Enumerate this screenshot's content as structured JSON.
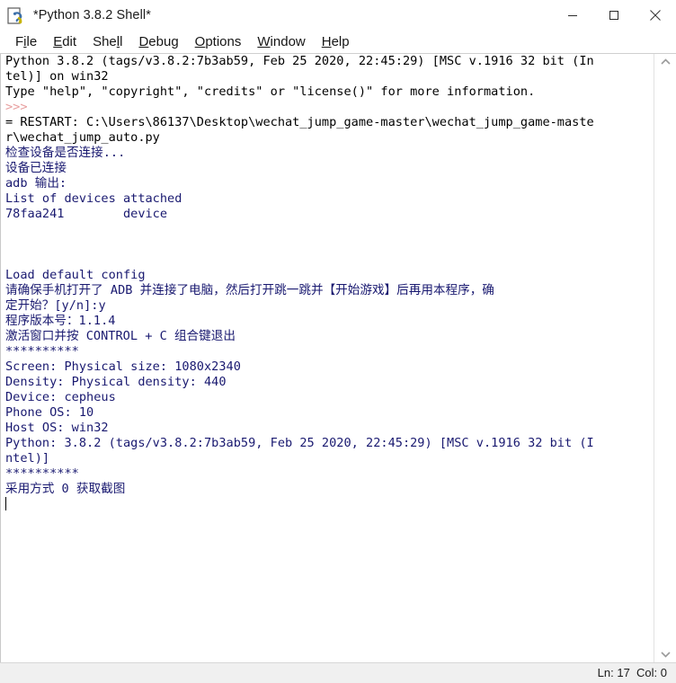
{
  "window": {
    "title": "*Python 3.8.2 Shell*",
    "icon": "python-idle-icon",
    "controls": {
      "minimize": "minimize-icon",
      "maximize": "maximize-icon",
      "close": "close-icon"
    }
  },
  "menubar": {
    "items": [
      {
        "label": "File",
        "pre": "F",
        "acc": "i",
        "post": "le"
      },
      {
        "label": "Edit",
        "pre": "",
        "acc": "E",
        "post": "dit"
      },
      {
        "label": "Shell",
        "pre": "She",
        "acc": "l",
        "post": "l"
      },
      {
        "label": "Debug",
        "pre": "",
        "acc": "D",
        "post": "ebug"
      },
      {
        "label": "Options",
        "pre": "",
        "acc": "O",
        "post": "ptions"
      },
      {
        "label": "Window",
        "pre": "",
        "acc": "W",
        "post": "indow"
      },
      {
        "label": "Help",
        "pre": "",
        "acc": "H",
        "post": "elp"
      }
    ]
  },
  "console": {
    "lines": [
      {
        "text": "Python 3.8.2 (tags/v3.8.2:7b3ab59, Feb 25 2020, 22:45:29) [MSC v.1916 32 bit (In",
        "style": "c-black"
      },
      {
        "text": "tel)] on win32",
        "style": "c-black"
      },
      {
        "text": "Type \"help\", \"copyright\", \"credits\" or \"license()\" for more information.",
        "style": "c-black"
      },
      {
        "text": ">>> ",
        "style": "c-prompt"
      },
      {
        "text": "= RESTART: C:\\Users\\86137\\Desktop\\wechat_jump_game-master\\wechat_jump_game-maste",
        "style": "c-black"
      },
      {
        "text": "r\\wechat_jump_auto.py",
        "style": "c-black"
      },
      {
        "text": "检查设备是否连接...",
        "style": "c-std"
      },
      {
        "text": "设备已连接",
        "style": "c-std"
      },
      {
        "text": "adb 输出:",
        "style": "c-std"
      },
      {
        "text": "List of devices attached",
        "style": "c-std"
      },
      {
        "text": "78faa241        device",
        "style": "c-std"
      },
      {
        "text": "",
        "style": "c-std"
      },
      {
        "text": "",
        "style": "c-std"
      },
      {
        "text": "",
        "style": "c-std"
      },
      {
        "text": "Load default config",
        "style": "c-std"
      },
      {
        "text": "请确保手机打开了 ADB 并连接了电脑，然后打开跳一跳并【开始游戏】后再用本程序，确",
        "style": "c-std"
      },
      {
        "text": "定开始？[y/n]:y",
        "style": "c-std"
      },
      {
        "text": "程序版本号：1.1.4",
        "style": "c-std"
      },
      {
        "text": "激活窗口并按 CONTROL + C 组合键退出",
        "style": "c-std"
      },
      {
        "text": "**********",
        "style": "c-std"
      },
      {
        "text": "Screen: Physical size: 1080x2340",
        "style": "c-std"
      },
      {
        "text": "Density: Physical density: 440",
        "style": "c-std"
      },
      {
        "text": "Device: cepheus",
        "style": "c-std"
      },
      {
        "text": "Phone OS: 10",
        "style": "c-std"
      },
      {
        "text": "Host OS: win32",
        "style": "c-std"
      },
      {
        "text": "Python: 3.8.2 (tags/v3.8.2:7b3ab59, Feb 25 2020, 22:45:29) [MSC v.1916 32 bit (I",
        "style": "c-std"
      },
      {
        "text": "ntel)]",
        "style": "c-std"
      },
      {
        "text": "**********",
        "style": "c-std"
      },
      {
        "text": "采用方式 0 获取截图",
        "style": "c-std"
      }
    ],
    "caret_line": 29
  },
  "scrollbar": {
    "up_arrow": "chevron-up-icon",
    "down_arrow": "chevron-down-icon"
  },
  "statusbar": {
    "position": "Ln: 17  Col: 0"
  }
}
